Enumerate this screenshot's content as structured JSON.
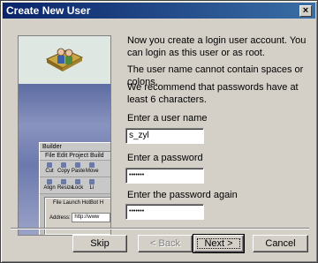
{
  "window": {
    "title": "Create New User",
    "close_glyph": "×"
  },
  "sidebar": {
    "logo_icon": "users-book-icon",
    "builder": {
      "title": "Builder",
      "menu": "File  Edit  Project  Build",
      "tools": [
        "Cut",
        "Copy",
        "Paste",
        "Move",
        "Align",
        "Resize",
        "Lock",
        "Li"
      ],
      "inner_menu": "File  Launch  HotBot  H",
      "address_label": "Address:",
      "address_value": "http://www"
    }
  },
  "content": {
    "intro": "Now you create a login user account. You can login as this user or as root.",
    "rule": "The user name cannot contain spaces or colons.",
    "recommend": "We recommend that passwords have at least 6 characters.",
    "username_label": "Enter a user name",
    "username_value": "s_zyl",
    "password_label": "Enter a password",
    "password_value": "•••••••",
    "password_again_label": "Enter the password again",
    "password_again_value": "•••••••"
  },
  "buttons": {
    "skip": "Skip",
    "back": "< Back",
    "next": "Next >",
    "cancel": "Cancel"
  }
}
